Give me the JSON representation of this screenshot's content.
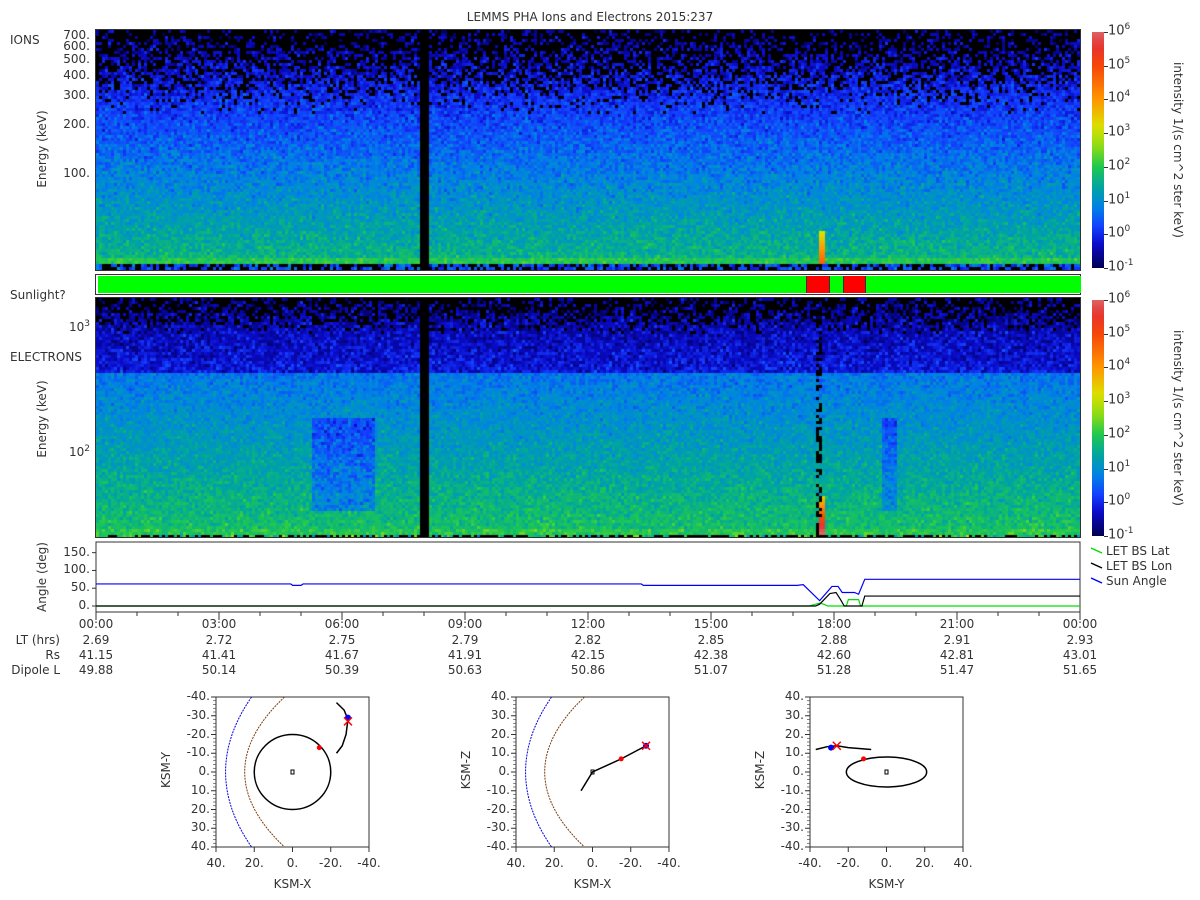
{
  "chart_data": [
    {
      "type": "heatmap",
      "title": "LEMMS PHA Ions and Electrons  2015:237",
      "panel_label": "IONS",
      "ylabel": "Energy (keV)",
      "yscale": "log",
      "ylim": [
        26,
        760
      ],
      "yticks": [
        "700.",
        "600.",
        "500.",
        "400.",
        "300.",
        "200.",
        "100."
      ],
      "ytick_values": [
        700,
        600,
        500,
        400,
        300,
        200,
        100
      ],
      "xlim_hours": [
        0,
        24
      ],
      "colorbar": {
        "label": "intensity 1/(s cm^2 ster keV)",
        "log_range": [
          -1,
          6
        ],
        "tick_exponents": [
          "6",
          "5",
          "4",
          "3",
          "2",
          "1",
          "0",
          "-1"
        ]
      },
      "data_gap_hours": [
        7.88,
        8.05
      ],
      "enhancement_hours": 17.65
    },
    {
      "type": "table",
      "label": "Sunlight?",
      "segments": [
        {
          "start": 0,
          "end": 17.32,
          "state": "sunlit",
          "color": "#00ff00"
        },
        {
          "start": 17.32,
          "end": 17.88,
          "state": "not sunlit",
          "color": "#ff0000"
        },
        {
          "start": 17.88,
          "end": 18.22,
          "state": "sunlit",
          "color": "#00ff00"
        },
        {
          "start": 18.22,
          "end": 18.76,
          "state": "not sunlit",
          "color": "#ff0000"
        },
        {
          "start": 18.76,
          "end": 24,
          "state": "sunlit",
          "color": "#00ff00"
        }
      ]
    },
    {
      "type": "heatmap",
      "panel_label": "ELECTRONS",
      "ylabel": "Energy (keV)",
      "yscale": "log",
      "ylim": [
        21,
        1740
      ],
      "yticks_exp": [
        {
          "base": "10",
          "exp": "3",
          "value": 1000
        },
        {
          "base": "10",
          "exp": "2",
          "value": 100
        }
      ],
      "colorbar": {
        "label": "intensity 1/(s cm^2 ster keV)",
        "log_range": [
          -1,
          6
        ],
        "tick_exponents": [
          "6",
          "5",
          "4",
          "3",
          "2",
          "1",
          "0",
          "-1"
        ]
      },
      "data_gap_hours": [
        7.88,
        8.05
      ],
      "enhancement_hours": 17.65
    },
    {
      "type": "line",
      "ylabel": "Angle (deg)",
      "ylim": [
        0,
        180
      ],
      "yticks": [
        "150.",
        "100.",
        "50.",
        "0."
      ],
      "ytick_values": [
        150,
        100,
        50,
        0
      ],
      "series": [
        {
          "name": "LET BS Lat",
          "color": "#00dd00",
          "x": [
            0,
            17.4,
            17.55,
            17.65,
            17.75,
            17.85,
            18.3,
            18.35,
            18.6,
            18.65,
            24
          ],
          "y": [
            0,
            0,
            5,
            8,
            5,
            0,
            0,
            18,
            18,
            0,
            0
          ]
        },
        {
          "name": "LET BS Lon",
          "color": "#000000",
          "x": [
            0,
            17.55,
            17.65,
            17.9,
            18.05,
            18.15,
            18.25,
            18.68,
            18.75,
            24
          ],
          "y": [
            0,
            0,
            5,
            35,
            38,
            20,
            0,
            0,
            28,
            28
          ]
        },
        {
          "name": "Sun Angle",
          "color": "#0000ff",
          "x": [
            0,
            4.75,
            4.8,
            5.0,
            5.05,
            13.3,
            13.35,
            17.1,
            17.25,
            17.65,
            17.95,
            18.1,
            18.2,
            18.5,
            18.6,
            18.75,
            24
          ],
          "y": [
            62,
            62,
            58,
            58,
            62,
            62,
            58,
            58,
            60,
            15,
            55,
            55,
            38,
            38,
            33,
            75,
            75
          ]
        }
      ],
      "legend": "right"
    }
  ],
  "time_axis": {
    "ticks": [
      "00:00",
      "03:00",
      "06:00",
      "09:00",
      "12:00",
      "15:00",
      "18:00",
      "21:00",
      "00:00"
    ],
    "rows": [
      {
        "label": "LT (hrs)",
        "values": [
          "2.69",
          "2.72",
          "2.75",
          "2.79",
          "2.82",
          "2.85",
          "2.88",
          "2.91",
          "2.93"
        ]
      },
      {
        "label": "Rs",
        "values": [
          "41.15",
          "41.41",
          "41.67",
          "41.91",
          "42.15",
          "42.38",
          "42.60",
          "42.81",
          "43.01"
        ]
      },
      {
        "label": "Dipole L",
        "values": [
          "49.88",
          "50.14",
          "50.39",
          "50.63",
          "50.86",
          "51.07",
          "51.28",
          "51.47",
          "51.65"
        ]
      }
    ]
  },
  "orbits": [
    {
      "xlabel": "KSM-X",
      "ylabel": "KSM-Y",
      "xticks": [
        "40.",
        "20.",
        "0.",
        "-20.",
        "-40."
      ],
      "yticks": [
        "-40.",
        "-30.",
        "-20.",
        "-10.",
        "0.",
        "10.",
        "20.",
        "30.",
        "40."
      ],
      "trajectory": [
        [
          -23,
          -37
        ],
        [
          -27,
          -33
        ],
        [
          -29,
          -28
        ],
        [
          -28,
          -20
        ],
        [
          -26,
          -14
        ],
        [
          -23,
          -10
        ]
      ],
      "inner": {
        "type": "circle",
        "r": 20
      },
      "red_dot": [
        -14,
        -13
      ],
      "blue_dot": [
        -29,
        -29
      ],
      "red_x": [
        -29,
        -27
      ]
    },
    {
      "xlabel": "KSM-X",
      "ylabel": "KSM-Z",
      "xticks": [
        "40.",
        "20.",
        "0.",
        "-20.",
        "-40."
      ],
      "yticks": [
        "40.",
        "30.",
        "20.",
        "10.",
        "0.",
        "-10.",
        "-20.",
        "-30.",
        "-40."
      ],
      "trajectory": [
        [
          6,
          -10
        ],
        [
          0,
          0
        ],
        [
          -15,
          7
        ],
        [
          -28,
          14
        ]
      ],
      "inner": null,
      "red_dot": [
        -15,
        7
      ],
      "blue_dot": [
        -28,
        14
      ],
      "red_x": [
        -28,
        14
      ]
    },
    {
      "xlabel": "KSM-Y",
      "ylabel": "KSM-Z",
      "xticks": [
        "-40.",
        "-20.",
        "0.",
        "20.",
        "40."
      ],
      "yticks": [
        "40.",
        "30.",
        "20.",
        "10.",
        "0.",
        "-10.",
        "-20.",
        "-30.",
        "-40."
      ],
      "trajectory": [
        [
          -37,
          12
        ],
        [
          -31,
          13.5
        ],
        [
          -26,
          14
        ],
        [
          -20,
          13
        ],
        [
          -8,
          12
        ]
      ],
      "inner": {
        "type": "ellipse",
        "rx": 21,
        "ry": 8
      },
      "red_dot": [
        -12,
        7
      ],
      "blue_dot": [
        -29,
        13
      ],
      "red_x": [
        -26,
        14
      ]
    }
  ]
}
